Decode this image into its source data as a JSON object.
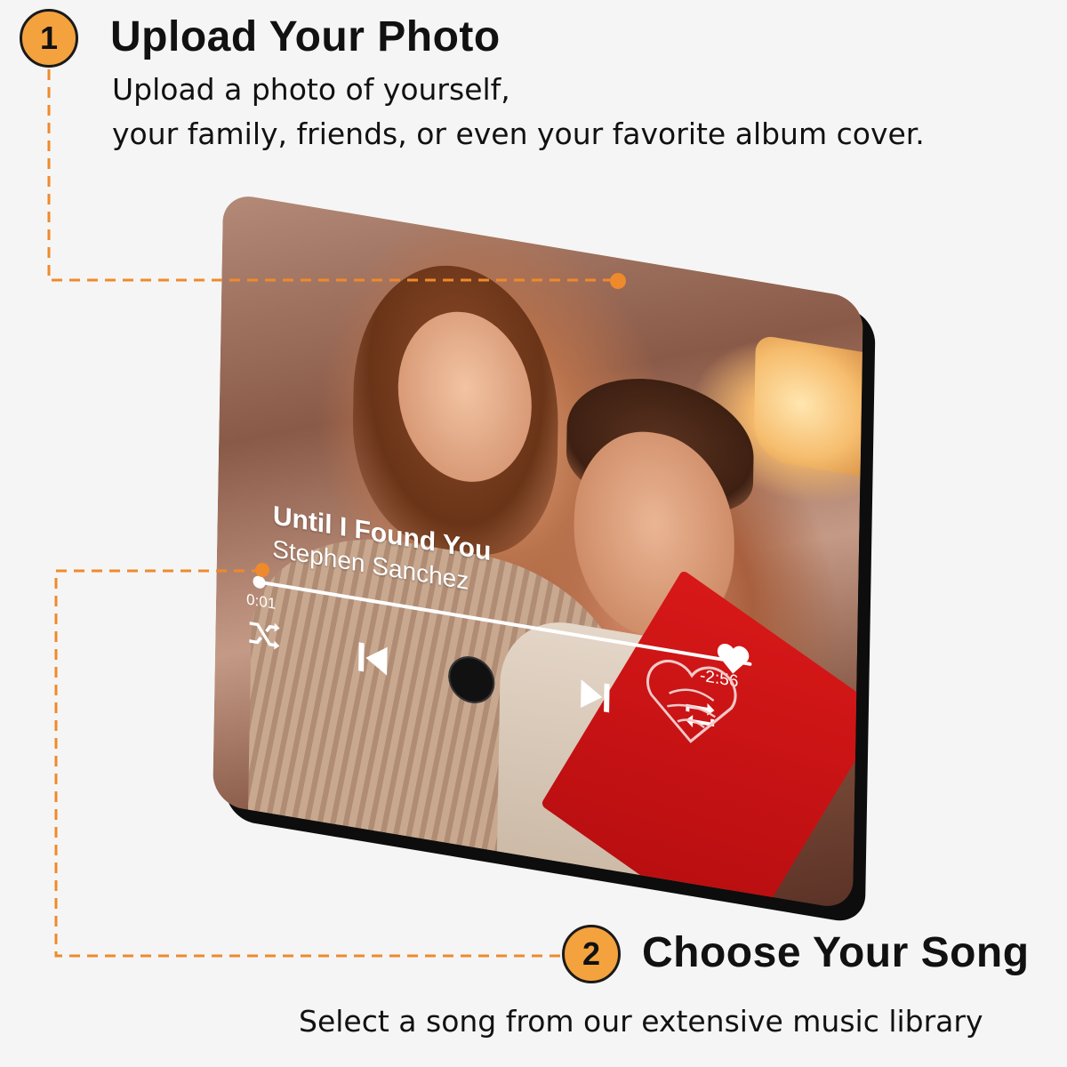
{
  "step1": {
    "number": "1",
    "title": "Upload Your Photo",
    "description_line1": "Upload a photo of yourself,",
    "description_line2": "your family, friends, or even your favorite album cover."
  },
  "step2": {
    "number": "2",
    "title": "Choose Your Song",
    "description": "Select a song from our extensive music library"
  },
  "player": {
    "song_title": "Until I Found You",
    "artist": "Stephen Sanchez",
    "time_elapsed": "0:01",
    "time_remaining": "-2:56",
    "progress": 0.01,
    "icons": [
      "shuffle-icon",
      "previous-icon",
      "play-icon",
      "next-icon",
      "heart-icon",
      "repeat-icon"
    ]
  },
  "colors": {
    "accent": "#f4a23e",
    "connector": "#ee8a2c",
    "background": "#f5f5f5",
    "card_red": "#c81216"
  }
}
